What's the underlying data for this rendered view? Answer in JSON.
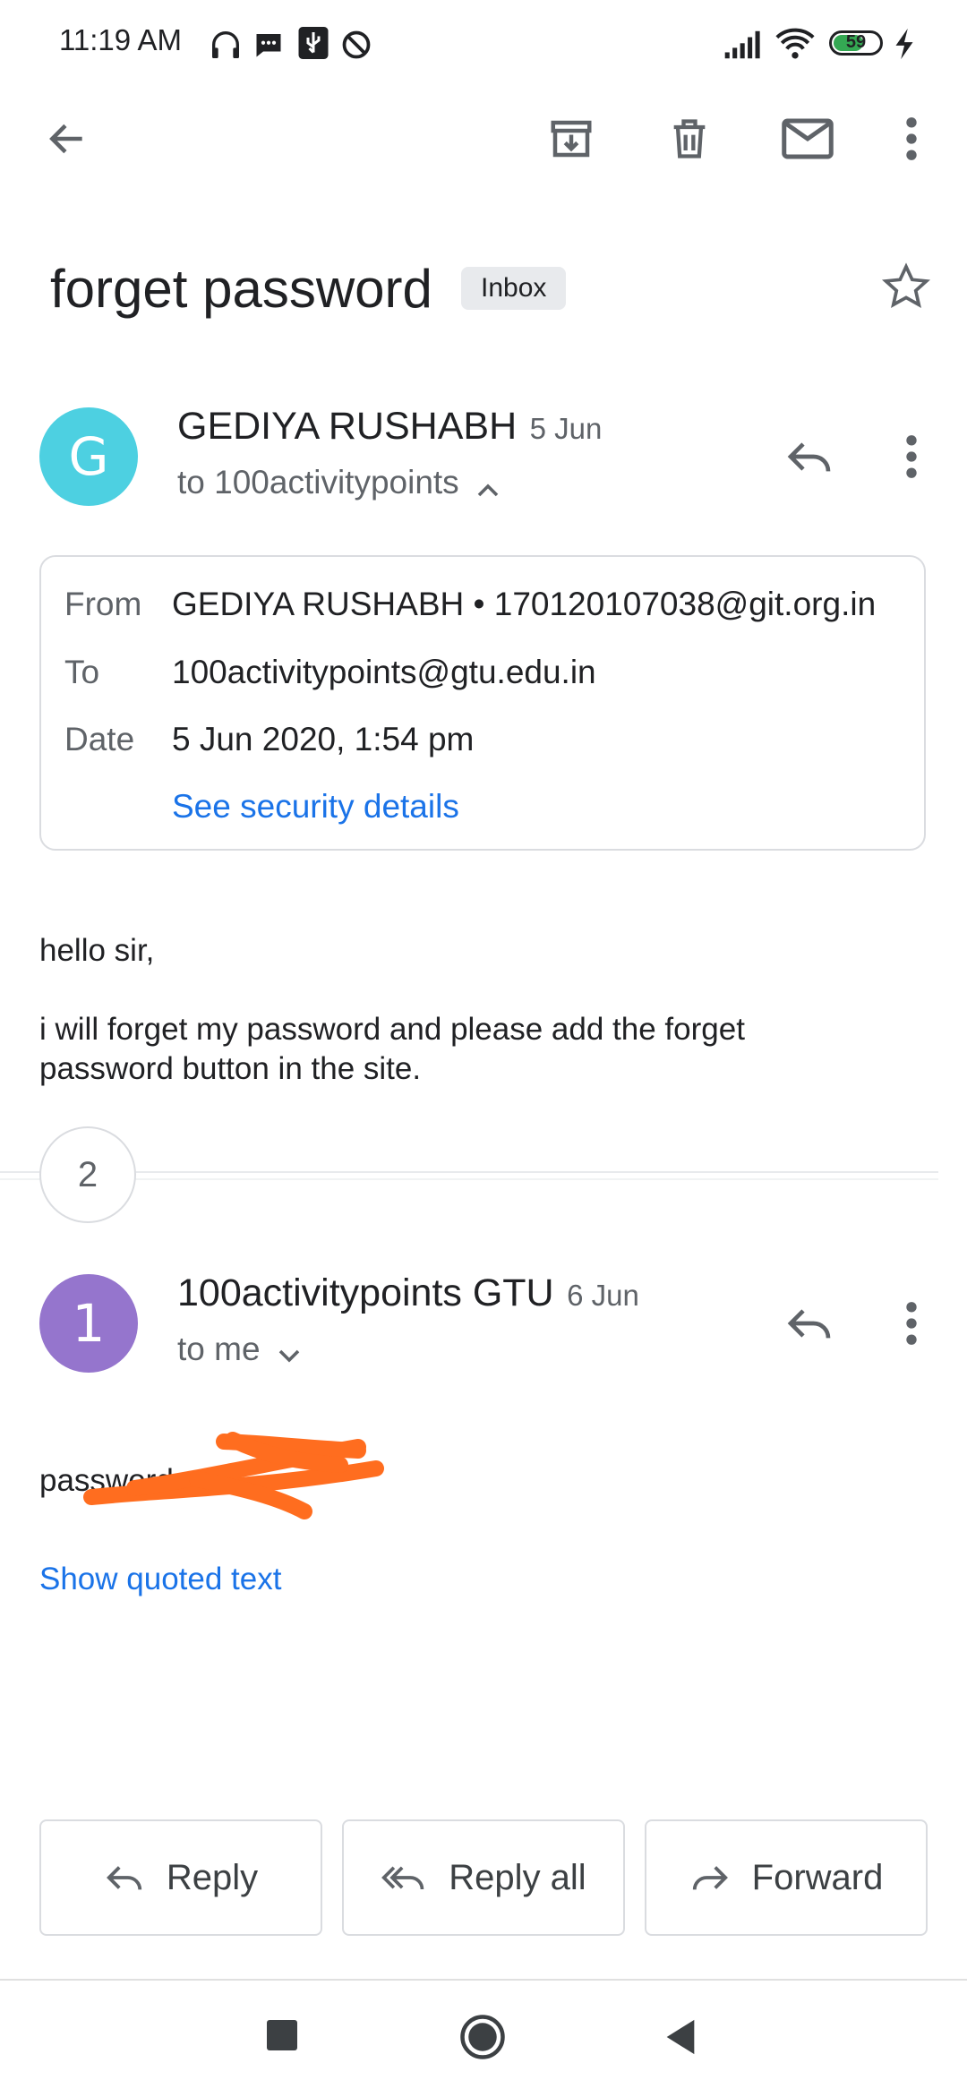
{
  "status_bar": {
    "time": "11:19 AM",
    "battery": "59"
  },
  "toolbar": {
    "icons": [
      "back-arrow-icon",
      "archive-icon",
      "delete-icon",
      "mark-unread-icon",
      "more-vert-icon"
    ]
  },
  "subject": {
    "title": "forget password",
    "label": "Inbox"
  },
  "message1": {
    "avatar_letter": "G",
    "avatar_color": "#4dd0e1",
    "sender": "GEDIYA RUSHABH",
    "date": "5 Jun",
    "to": "to 100activitypoints",
    "details": {
      "from_label": "From",
      "from_value": "GEDIYA RUSHABH • 170120107038@git.org.in",
      "to_label": "To",
      "to_value": "100activitypoints@gtu.edu.in",
      "date_label": "Date",
      "date_value": "5 Jun 2020, 1:54 pm",
      "security_link": "See security details"
    },
    "body_greeting": "hello sir,",
    "body_line1": "i will forget my password and please add the forget",
    "body_line2": "password button in the site."
  },
  "collapsed_count": "2",
  "message2": {
    "avatar_letter": "1",
    "avatar_color": "#9575cd",
    "sender": "100activitypoints GTU",
    "date": "6 Jun",
    "to": "to me",
    "body": "password",
    "show_quoted": "Show quoted text"
  },
  "actions": {
    "reply": "Reply",
    "reply_all": "Reply all",
    "forward": "Forward"
  },
  "colors": {
    "accent_link": "#1a73e8",
    "redaction": "#ff6d1f"
  }
}
